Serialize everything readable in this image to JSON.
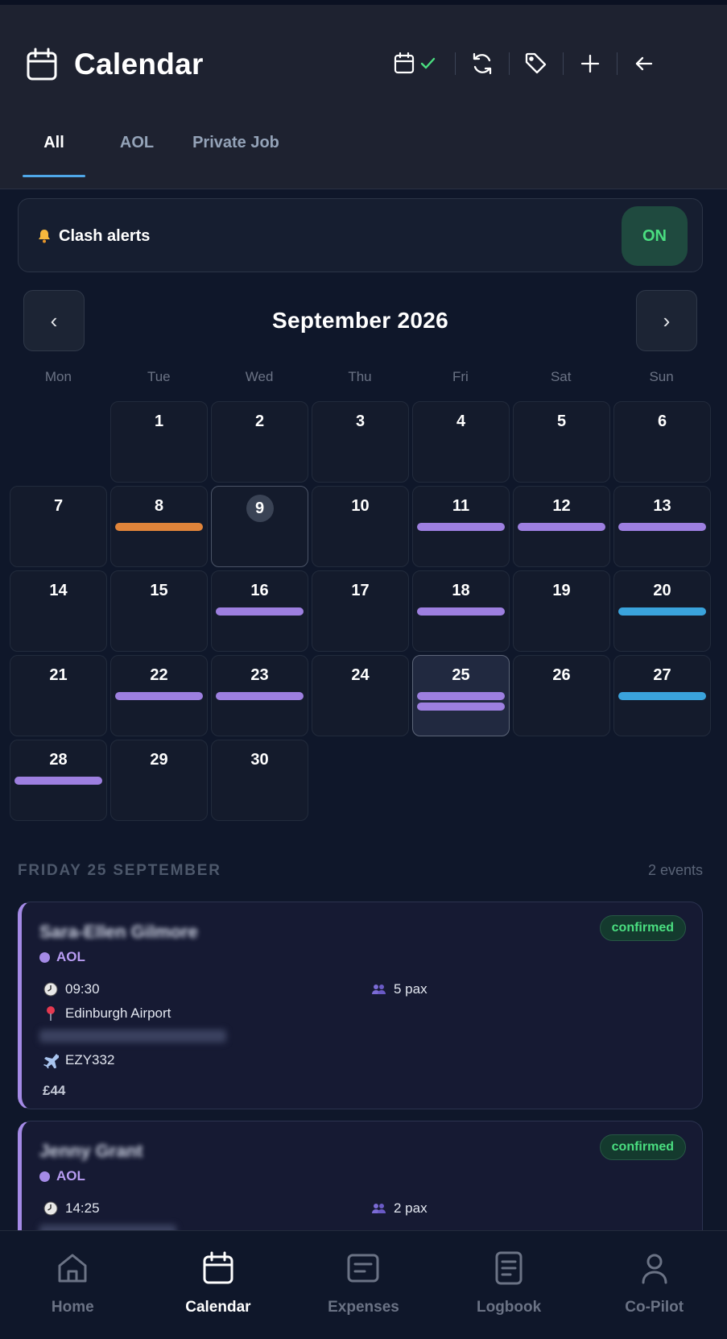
{
  "header": {
    "title": "Calendar",
    "toolbar": [
      {
        "name": "calendar-sync-button",
        "icon": "calendar-check-icon"
      },
      {
        "name": "refresh-button",
        "icon": "refresh-icon"
      },
      {
        "name": "tags-button",
        "icon": "tag-icon"
      },
      {
        "name": "add-button",
        "icon": "plus-icon"
      },
      {
        "name": "back-button",
        "icon": "arrow-left-icon"
      }
    ]
  },
  "tabs": [
    "All",
    "AOL",
    "Private Job"
  ],
  "active_tab": "All",
  "clash_alerts": {
    "label": "Clash alerts",
    "icon": "bell-icon",
    "toggle": "ON"
  },
  "month_nav": {
    "prev": "‹",
    "next": "›",
    "title": "September 2026"
  },
  "weekdays": [
    "Mon",
    "Tue",
    "Wed",
    "Thu",
    "Fri",
    "Sat",
    "Sun"
  ],
  "colors": {
    "aol": "#9d7fe0",
    "private": "#e0843a",
    "other": "#3aa3dc",
    "confirmed": "#4ade80"
  },
  "calendar": {
    "first_weekday_offset": 1,
    "days": [
      {
        "d": "1",
        "events": []
      },
      {
        "d": "2",
        "events": []
      },
      {
        "d": "3",
        "events": []
      },
      {
        "d": "4",
        "events": []
      },
      {
        "d": "5",
        "events": []
      },
      {
        "d": "6",
        "events": []
      },
      {
        "d": "7",
        "events": []
      },
      {
        "d": "8",
        "events": [
          "#e0843a"
        ]
      },
      {
        "d": "9",
        "events": [],
        "today": true
      },
      {
        "d": "10",
        "events": []
      },
      {
        "d": "11",
        "events": [
          "#9d7fe0"
        ]
      },
      {
        "d": "12",
        "events": [
          "#9d7fe0"
        ]
      },
      {
        "d": "13",
        "events": [
          "#9d7fe0"
        ]
      },
      {
        "d": "14",
        "events": []
      },
      {
        "d": "15",
        "events": []
      },
      {
        "d": "16",
        "events": [
          "#9d7fe0"
        ]
      },
      {
        "d": "17",
        "events": []
      },
      {
        "d": "18",
        "events": [
          "#9d7fe0"
        ]
      },
      {
        "d": "19",
        "events": []
      },
      {
        "d": "20",
        "events": [
          "#3aa3dc"
        ]
      },
      {
        "d": "21",
        "events": []
      },
      {
        "d": "22",
        "events": [
          "#9d7fe0"
        ]
      },
      {
        "d": "23",
        "events": [
          "#9d7fe0"
        ]
      },
      {
        "d": "24",
        "events": []
      },
      {
        "d": "25",
        "events": [
          "#9d7fe0",
          "#9d7fe0"
        ],
        "selected": true
      },
      {
        "d": "26",
        "events": []
      },
      {
        "d": "27",
        "events": [
          "#3aa3dc"
        ]
      },
      {
        "d": "28",
        "events": [
          "#9d7fe0"
        ]
      },
      {
        "d": "29",
        "events": []
      },
      {
        "d": "30",
        "events": []
      }
    ]
  },
  "day_detail": {
    "title": "FRIDAY 25 SEPTEMBER",
    "count": "2 events",
    "events": [
      {
        "name": "Sara-Ellen Gilmore",
        "status": "confirmed",
        "category": "AOL",
        "time": "09:30",
        "pax": "5 pax",
        "location": "Edinburgh Airport",
        "flight": "EZY332",
        "price": "£44"
      },
      {
        "name": "Jenny Grant",
        "status": "confirmed",
        "category": "AOL",
        "time": "14:25",
        "pax": "2 pax"
      }
    ]
  },
  "bottom_nav": [
    {
      "label": "Home",
      "icon": "home-icon"
    },
    {
      "label": "Calendar",
      "icon": "calendar-icon",
      "active": true
    },
    {
      "label": "Expenses",
      "icon": "receipt-icon"
    },
    {
      "label": "Logbook",
      "icon": "document-icon"
    },
    {
      "label": "Co-Pilot",
      "icon": "user-icon"
    }
  ]
}
